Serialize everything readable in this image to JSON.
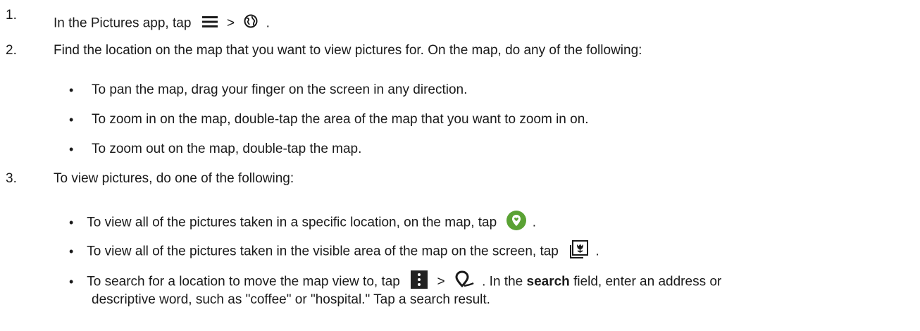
{
  "steps": [
    {
      "number": "1.",
      "pre": "In the Pictures app, tap",
      "sep": ">",
      "post": "."
    },
    {
      "number": "2.",
      "text": "Find the location on the map that you want to view pictures for. On the map, do any of the following:"
    },
    {
      "number": "3.",
      "text": "To view pictures, do one of the following:"
    }
  ],
  "step2_bullets": [
    "To pan the map, drag your finger on the screen in any direction.",
    "To zoom in on the map, double-tap the area of the map that you want to zoom in on.",
    "To zoom out on the map, double-tap the map."
  ],
  "step3_bullets": {
    "b1": {
      "pre": "To view all of the pictures taken in a specific location, on the map, tap",
      "post": "."
    },
    "b2": {
      "pre": "To view all of the pictures taken in the visible area of the map on the screen, tap",
      "post": "."
    },
    "b3": {
      "pre": "To search for a location to move the map view to, tap",
      "sep": ">",
      "mid": ". In the",
      "bold": "search",
      "rest": "field, enter an address or",
      "line2": "descriptive word, such as \"coffee\" or \"hospital.\" Tap a search result."
    }
  },
  "bullet_char": "•",
  "icons": [
    "menu-icon",
    "globe-icon",
    "location-pin-icon",
    "gallery-icon",
    "more-vert-icon",
    "search-location-icon"
  ],
  "colors": {
    "text": "#1a1a1a",
    "green": "#5aa234",
    "dark": "#222222"
  }
}
